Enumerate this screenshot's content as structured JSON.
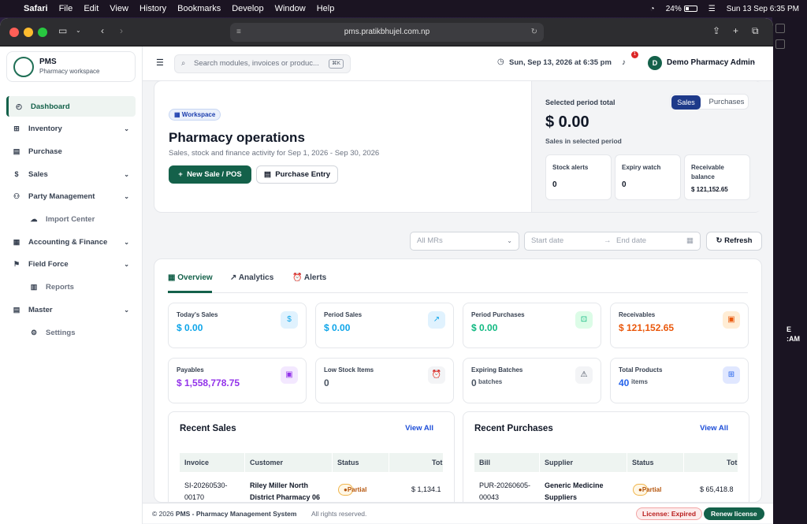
{
  "menubar": {
    "app": "Safari",
    "items": [
      "File",
      "Edit",
      "View",
      "History",
      "Bookmarks",
      "Develop",
      "Window",
      "Help"
    ],
    "battery": "24%",
    "clock": "Sun 13 Sep  6:35 PM"
  },
  "browser": {
    "url": "pms.pratikbhujel.com.np"
  },
  "desktop": {
    "time_fragment": "E\n:AM"
  },
  "brand": {
    "name": "PMS",
    "subtitle": "Pharmacy workspace"
  },
  "sidebar": {
    "items": [
      {
        "label": "Dashboard",
        "icon": "dashboard-icon",
        "chevron": false,
        "sub": false,
        "active": true
      },
      {
        "label": "Inventory",
        "icon": "inventory-icon",
        "chevron": true,
        "sub": false
      },
      {
        "label": "Purchase",
        "icon": "purchase-icon",
        "chevron": false,
        "sub": false
      },
      {
        "label": "Sales",
        "icon": "sales-icon",
        "chevron": true,
        "sub": false
      },
      {
        "label": "Party Management",
        "icon": "party-icon",
        "chevron": true,
        "sub": false
      },
      {
        "label": "Import Center",
        "icon": "cloud-icon",
        "chevron": false,
        "sub": true
      },
      {
        "label": "Accounting & Finance",
        "icon": "accounting-icon",
        "chevron": true,
        "sub": false
      },
      {
        "label": "Field Force",
        "icon": "field-force-icon",
        "chevron": true,
        "sub": false
      },
      {
        "label": "Reports",
        "icon": "reports-icon",
        "chevron": false,
        "sub": true
      },
      {
        "label": "Master",
        "icon": "master-icon",
        "chevron": true,
        "sub": false
      },
      {
        "label": "Settings",
        "icon": "gear-icon",
        "chevron": false,
        "sub": true
      }
    ]
  },
  "topbar": {
    "search_placeholder": "Search modules, invoices or produc...",
    "search_kbd": "⌘K",
    "datetime": "Sun, Sep 13, 2026 at 6:35 pm",
    "notif_count": "1",
    "avatar": "D",
    "user": "Demo Pharmacy Admin"
  },
  "hero": {
    "pill": "Workspace",
    "title": "Pharmacy operations",
    "subtitle": "Sales, stock and finance activity for Sep 1, 2026 - Sep 30, 2026",
    "new_sale": "New Sale / POS",
    "purchase_entry": "Purchase Entry",
    "selected_label": "Selected period total",
    "toggle_on": "Sales",
    "toggle_off": "Purchases",
    "amount": "$ 0.00",
    "amount_sub": "Sales in selected period",
    "minis": [
      {
        "label": "Stock alerts",
        "value": "0"
      },
      {
        "label": "Expiry watch",
        "value": "0"
      },
      {
        "label": "Receivable balance",
        "value": "$ 121,152.65"
      }
    ]
  },
  "filters": {
    "mr_placeholder": "All MRs",
    "start": "Start date",
    "end": "End date",
    "refresh": "Refresh"
  },
  "tabs": [
    {
      "label": "Overview",
      "icon": "overview-icon"
    },
    {
      "label": "Analytics",
      "icon": "analytics-icon"
    },
    {
      "label": "Alerts",
      "icon": "alerts-icon"
    }
  ],
  "stats": [
    {
      "label": "Today's Sales",
      "value": "$ 0.00",
      "suffix": "",
      "color": "#0ea5e9",
      "icon": "dollar-icon",
      "glyph": "$"
    },
    {
      "label": "Period Sales",
      "value": "$ 0.00",
      "suffix": "",
      "color": "#0ea5e9",
      "icon": "chart-icon",
      "glyph": "↗"
    },
    {
      "label": "Period Purchases",
      "value": "$ 0.00",
      "suffix": "",
      "color": "#10b981",
      "icon": "cart-icon",
      "glyph": "⊡"
    },
    {
      "label": "Receivables",
      "value": "$ 121,152.65",
      "suffix": "",
      "color": "#ea580c",
      "icon": "receivable-icon",
      "glyph": "▣"
    },
    {
      "label": "Payables",
      "value": "$ 1,558,778.75",
      "suffix": "",
      "color": "#9333ea",
      "icon": "payable-icon",
      "glyph": "▣"
    },
    {
      "label": "Low Stock Items",
      "value": "0",
      "suffix": "",
      "color": "#4b5563",
      "icon": "alarm-icon",
      "glyph": "⏰"
    },
    {
      "label": "Expiring Batches",
      "value": "0",
      "suffix": "batches",
      "color": "#4b5563",
      "icon": "warning-icon",
      "glyph": "⚠"
    },
    {
      "label": "Total Products",
      "value": "40",
      "suffix": "items",
      "color": "#2563eb",
      "icon": "box-icon",
      "glyph": "⊞"
    }
  ],
  "recent_sales": {
    "title": "Recent Sales",
    "view_all": "View All",
    "cols": [
      "Invoice",
      "Customer",
      "Status",
      "Tot"
    ],
    "row": {
      "id": "SI-20260530-\n00170",
      "party": "Riley Miller North\nDistrict Pharmacy 06",
      "status": "Partial",
      "total": "$ 1,134.1"
    }
  },
  "recent_purchases": {
    "title": "Recent Purchases",
    "view_all": "View All",
    "cols": [
      "Bill",
      "Supplier",
      "Status",
      "Tot"
    ],
    "row": {
      "id": "PUR-20260605-\n00043",
      "party": "Generic Medicine\nSuppliers",
      "status": "Partial",
      "total": "$ 65,418.8"
    }
  },
  "footer": {
    "copyright_prefix": "© 2026 ",
    "copyright_bold": "PMS - Pharmacy Management System",
    "rights": "All rights reserved.",
    "license": "License: Expired",
    "renew": "Renew license"
  }
}
